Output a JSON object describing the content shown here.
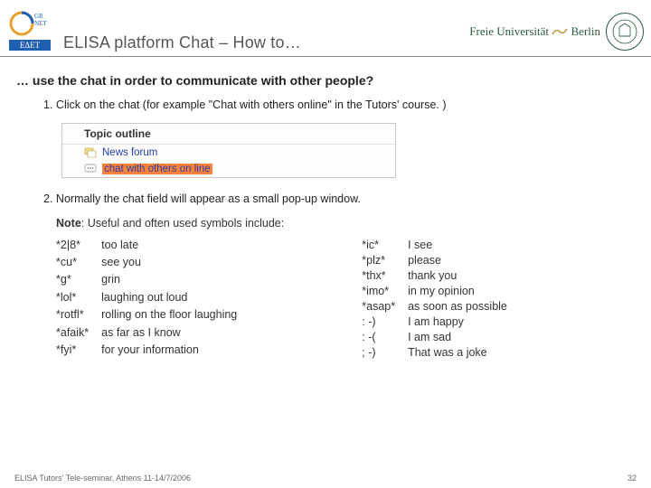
{
  "header": {
    "left_logo_top": "GRNET",
    "left_logo_bottom": "ΕΔΕΤ",
    "title": "ELISA platform Chat – How to…",
    "fu_line1": "Freie Universität",
    "fu_line2": "Berlin",
    "fu_seal": "FU"
  },
  "subhead": "… use the chat in order to communicate with other people?",
  "step1": {
    "num": "1.",
    "text": "Click on the chat (for example \"Chat with others online\" in the Tutors' course. )"
  },
  "course": {
    "outline": "Topic outline",
    "news": "News forum",
    "chat": "chat with others on line"
  },
  "step2": {
    "num": "2.",
    "text": "Normally the chat field will appear as a small pop-up window."
  },
  "note": {
    "label": "Note",
    "text": ": Useful and often used symbols include:"
  },
  "symbols_left": [
    {
      "abbr": "*2|8*",
      "mean": "too late"
    },
    {
      "abbr": "*cu*",
      "mean": "see you"
    },
    {
      "abbr": "*g*",
      "mean": "grin"
    },
    {
      "abbr": "*lol*",
      "mean": "laughing out loud"
    },
    {
      "abbr": "*rotfl*",
      "mean": "rolling on the floor laughing"
    },
    {
      "abbr": "*afaik*",
      "mean": "as far as I know"
    },
    {
      "abbr": "*fyi*",
      "mean": "for your information"
    }
  ],
  "symbols_right": [
    {
      "abbr": "*ic*",
      "mean": "I see"
    },
    {
      "abbr": "*plz*",
      "mean": "please"
    },
    {
      "abbr": "*thx*",
      "mean": "thank you"
    },
    {
      "abbr": "*imo*",
      "mean": "in my opinion"
    },
    {
      "abbr": "*asap*",
      "mean": "as soon as possible"
    },
    {
      "abbr": ": -)",
      "mean": "I am happy"
    },
    {
      "abbr": ": -(",
      "mean": "I am sad"
    },
    {
      "abbr": "; -)",
      "mean": "That was a joke"
    }
  ],
  "footer": {
    "left": "ELISA Tutors' Tele-seminar, Athens 11-14/7/2006",
    "right": "32"
  }
}
